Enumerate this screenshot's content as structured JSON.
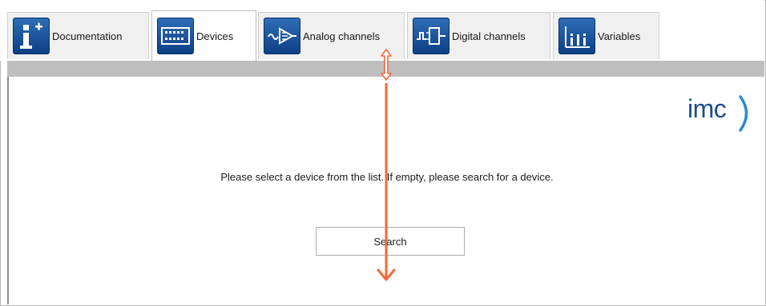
{
  "tabs": [
    {
      "label": "Documentation",
      "icon": "info-plus-icon",
      "active": false
    },
    {
      "label": "Devices",
      "icon": "device-panel-icon",
      "active": true
    },
    {
      "label": "Analog channels",
      "icon": "analog-channel-icon",
      "active": false
    },
    {
      "label": "Digital channels",
      "icon": "digital-channel-icon",
      "active": false
    },
    {
      "label": "Variables",
      "icon": "variables-icon",
      "active": false
    }
  ],
  "logo": {
    "text": "imc"
  },
  "main": {
    "message": "Please select a device from the list. If empty, please search for a device.",
    "search_label": "Search"
  },
  "colors": {
    "tab_icon_blue": "#1a56a0",
    "annotation_arrow": "#f26a3d",
    "logo_blue": "#1b4e91",
    "strip_grey": "#bebebe"
  }
}
